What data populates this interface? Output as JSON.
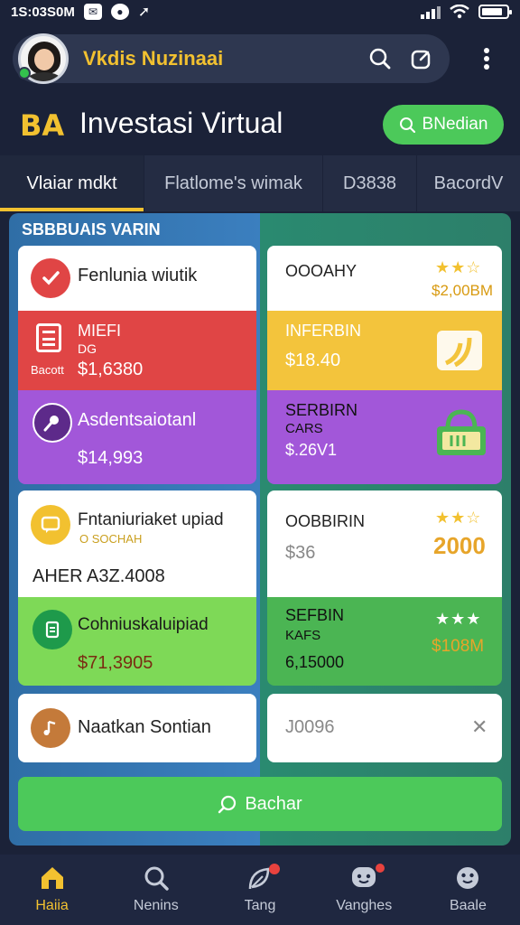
{
  "status_bar": {
    "time": "1S:03S0M"
  },
  "header": {
    "user_name": "Vkdis Nuzinaai"
  },
  "brand": {
    "logo_text": "BA",
    "title": "Investasi Virtual",
    "action_label": "BNedian"
  },
  "tabs": [
    {
      "label": "Vlaiar mdkt",
      "active": true
    },
    {
      "label": "Flatlome's wimak",
      "active": false
    },
    {
      "label": "D3838",
      "active": false
    },
    {
      "label": "BacordV",
      "active": false
    }
  ],
  "section_label": "SBBBUAIS VARIN",
  "cards": {
    "left": [
      {
        "title": "Fenlunia wiutik",
        "color": "#ffffff"
      },
      {
        "title": "MIEFI",
        "sub": "DG",
        "small": "Bacott",
        "value": "$1,6380",
        "color": "#e04545"
      },
      {
        "title": "Asdentsaiotanl",
        "value": "$14,993",
        "color": "#a257d9"
      },
      {
        "title": "Fntaniuriaket upiad",
        "sub": "O SOCHAH",
        "extra": "AHER A3Z.4008",
        "color": "#ffffff"
      },
      {
        "title": "Cohniuskaluipiad",
        "value": "$71,3905",
        "color": "#7ed957"
      },
      {
        "title": "Naatkan Sontian",
        "color": "#ffffff"
      }
    ],
    "right": [
      {
        "title": "OOOAHY",
        "rating": "★★☆",
        "value": "$2,00BM",
        "color": "#ffffff"
      },
      {
        "title": "INFERBIN",
        "value": "$18.40",
        "color": "#f3c43c"
      },
      {
        "title": "SERBIRN",
        "sub": "CARS",
        "value": "$.26V1",
        "color": "#a257d9"
      },
      {
        "title": "OOBBIRIN",
        "rating": "★★☆",
        "value": "$36",
        "big": "2000",
        "color": "#ffffff"
      },
      {
        "title": "SEFBIN",
        "sub": "KAFS",
        "value": "6,15000",
        "rating": "★★★",
        "big": "$108M",
        "color": "#4bb553"
      },
      {
        "title": "J0096",
        "close": "✕",
        "color": "#ffffff"
      }
    ]
  },
  "cta_label": "Bachar",
  "bottom_nav": [
    {
      "label": "Haiia",
      "icon": "home-icon",
      "active": true
    },
    {
      "label": "Nenins",
      "icon": "search-icon",
      "active": false
    },
    {
      "label": "Tang",
      "icon": "leaf-icon",
      "active": false
    },
    {
      "label": "Vanghes",
      "icon": "chat-face-icon",
      "active": false
    },
    {
      "label": "Baale",
      "icon": "smile-face-icon",
      "active": false
    }
  ],
  "colors": {
    "accent_yellow": "#f2c130",
    "accent_green": "#4cc95a",
    "background": "#1b2238"
  }
}
